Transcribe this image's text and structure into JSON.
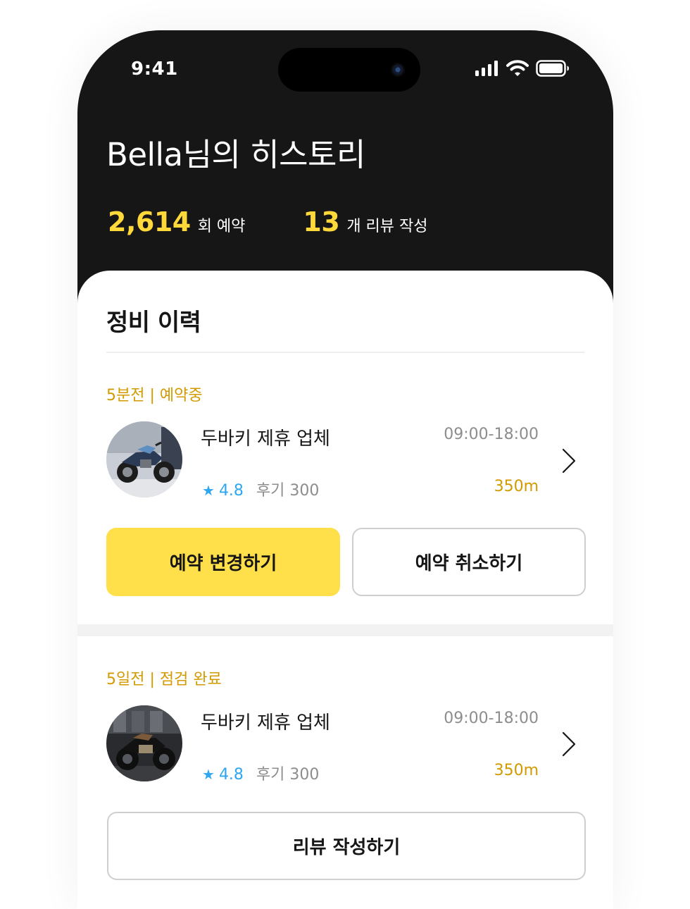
{
  "status_bar": {
    "time": "9:41"
  },
  "header": {
    "title": "Bella님의 히스토리",
    "stats": [
      {
        "value": "2,614",
        "label": "회 예약"
      },
      {
        "value": "13",
        "label": "개 리뷰 작성"
      }
    ]
  },
  "section": {
    "title": "정비 이력"
  },
  "history": [
    {
      "when": "5분전 | 예약중",
      "shop_name": "두바키 제휴 업체",
      "hours": "09:00-18:00",
      "rating": "4.8",
      "reviews": "후기 300",
      "distance": "350m",
      "buttons": [
        "예약 변경하기",
        "예약 취소하기"
      ]
    },
    {
      "when": "5일전 | 점검 완료",
      "shop_name": "두바키 제휴 업체",
      "hours": "09:00-18:00",
      "rating": "4.8",
      "reviews": "후기 300",
      "distance": "350m",
      "buttons": [
        "리뷰 작성하기"
      ]
    }
  ],
  "colors": {
    "header_bg": "#161616",
    "accent_yellow": "#ffd93a",
    "button_yellow": "#ffe04a",
    "status_orange": "#d39a00",
    "rating_blue": "#2fa6f0"
  },
  "icons": [
    "signal-icon",
    "wifi-icon",
    "battery-icon",
    "star-icon",
    "chevron-right-icon"
  ]
}
